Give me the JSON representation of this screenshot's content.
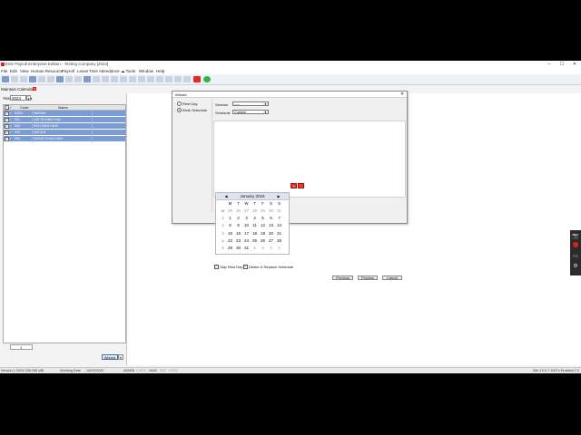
{
  "window": {
    "title": "ESS Payroll Enterprise Edition - Testing Company [2024]",
    "controls": [
      "–",
      "☐",
      "✕"
    ]
  },
  "menu": [
    "File",
    "Edit",
    "View",
    "Human Resource",
    "Payroll",
    "Leave",
    "Time Attendance",
    "Tools",
    "Window",
    "Help"
  ],
  "tab": {
    "label": "Maintain Calendar",
    "close": "x"
  },
  "left_panel": {
    "year_label": "Year",
    "year_value": "2024",
    "grid_headers": {
      "code": "Code",
      "name": "Name"
    },
    "rows": [
      {
        "code": "DG01",
        "name": "MARIAH"
      },
      {
        "code": "001",
        "name": "LEE CHONG HUA"
      },
      {
        "code": "002",
        "name": "KOH KIAN HUAT"
      },
      {
        "code": "003",
        "name": "NICOLE"
      },
      {
        "code": "004",
        "name": "WONG CHUN HAN"
      }
    ],
    "page_value": "1",
    "wizard_button": "Wizard"
  },
  "dialog": {
    "title": "Wizard",
    "close": "✕",
    "options": [
      {
        "label": "Rest Day",
        "selected": false
      },
      {
        "label": "Work Schedule",
        "selected": true
      }
    ],
    "session_label": "Session",
    "session_value": "-----",
    "schedule_label": "Schedule",
    "schedule_value": "Custom",
    "add_btn": "+",
    "remove_btn": "-",
    "calendar": {
      "month": "January 2024",
      "prev": "◀",
      "next": "▶",
      "dow": [
        "M",
        "T",
        "W",
        "T",
        "F",
        "S",
        "S"
      ],
      "weeks": [
        {
          "wk": "W",
          "days": [
            "25",
            "26",
            "27",
            "28",
            "29",
            "30",
            "31"
          ]
        },
        {
          "wk": "1",
          "days": [
            "1",
            "2",
            "3",
            "4",
            "5",
            "6",
            "7"
          ]
        },
        {
          "wk": "2",
          "days": [
            "8",
            "9",
            "10",
            "11",
            "12",
            "13",
            "14"
          ]
        },
        {
          "wk": "3",
          "days": [
            "15",
            "16",
            "17",
            "18",
            "19",
            "20",
            "21"
          ]
        },
        {
          "wk": "4",
          "days": [
            "22",
            "23",
            "24",
            "25",
            "26",
            "27",
            "28"
          ]
        },
        {
          "wk": "5",
          "days": [
            "29",
            "30",
            "31",
            "1",
            "2",
            "3",
            "4"
          ]
        }
      ]
    },
    "skip_rest_day": "Skip Rest Day",
    "delete_replace": "Delete & Replace Schedule",
    "buttons": {
      "previous": "Previous",
      "process": "Process",
      "cancel": "Cancel"
    }
  },
  "status": {
    "version": "Version 1.2024.236.265 x86",
    "working_date_label": "Working Date",
    "working_date": "14/03/2024",
    "user": "ADMIN",
    "caps": "CAPS",
    "num": "NUM",
    "ins": "INS",
    "scrl": "SCRL",
    "right": "Win 10.0.7.10074 Enabled 2.0"
  },
  "colors": {
    "selection": "#7b9bd6",
    "accent_red": "#e23a1f",
    "titlebar": "#ffffff"
  }
}
